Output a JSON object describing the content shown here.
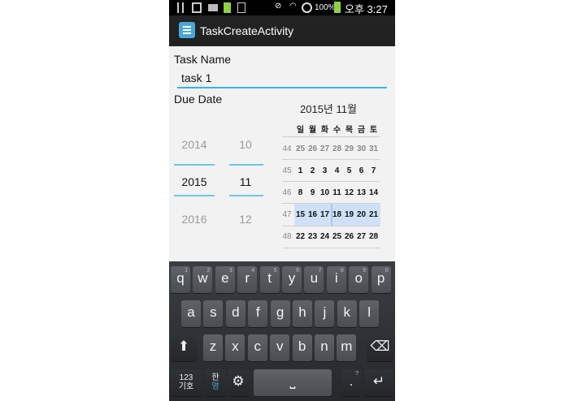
{
  "status_bar": {
    "battery_percent": "100%",
    "time": "오후 3:27",
    "icons": [
      "usb-icon",
      "image-icon",
      "keyboard-icon",
      "battery-icon",
      "document-icon",
      "mute-icon",
      "wifi-icon",
      "block-icon",
      "battery-icon"
    ]
  },
  "action_bar": {
    "title": "TaskCreateActivity",
    "icon": "app-icon"
  },
  "form": {
    "task_name_label": "Task Name",
    "task_name_value": "task 1",
    "due_date_label": "Due Date"
  },
  "date_picker": {
    "years": {
      "prev": "2014",
      "current": "2015",
      "next": "2016"
    },
    "months": {
      "prev": "10",
      "current": "11",
      "next": "12"
    },
    "calendar": {
      "month_title": "2015년 11월",
      "weekdays": [
        "일",
        "월",
        "화",
        "수",
        "목",
        "금",
        "토"
      ],
      "weeks": [
        {
          "num": "44",
          "days": [
            "25",
            "26",
            "27",
            "28",
            "29",
            "30",
            "31"
          ],
          "dim": true
        },
        {
          "num": "45",
          "days": [
            "1",
            "2",
            "3",
            "4",
            "5",
            "6",
            "7"
          ]
        },
        {
          "num": "46",
          "days": [
            "8",
            "9",
            "10",
            "11",
            "12",
            "13",
            "14"
          ]
        },
        {
          "num": "47",
          "days": [
            "15",
            "16",
            "17",
            "18",
            "19",
            "20",
            "21"
          ],
          "selected": true
        },
        {
          "num": "48",
          "days": [
            "22",
            "23",
            "24",
            "25",
            "26",
            "27",
            "28"
          ]
        }
      ],
      "selected_day": "18"
    }
  },
  "keyboard": {
    "row1": [
      [
        "q",
        "1"
      ],
      [
        "w",
        "2"
      ],
      [
        "e",
        "3"
      ],
      [
        "r",
        "4"
      ],
      [
        "t",
        "5"
      ],
      [
        "y",
        "6"
      ],
      [
        "u",
        "7"
      ],
      [
        "i",
        "8"
      ],
      [
        "o",
        "9"
      ],
      [
        "p",
        "0"
      ]
    ],
    "row2": [
      "a",
      "s",
      "d",
      "f",
      "g",
      "h",
      "j",
      "k",
      "l"
    ],
    "row3": [
      "z",
      "x",
      "c",
      "v",
      "b",
      "n",
      "m"
    ],
    "num_key": "123",
    "num_key_sub": "기호",
    "lang_key": "한",
    "lang_key_sub": "영",
    "period_key": ".",
    "period_key_sup": "?"
  }
}
